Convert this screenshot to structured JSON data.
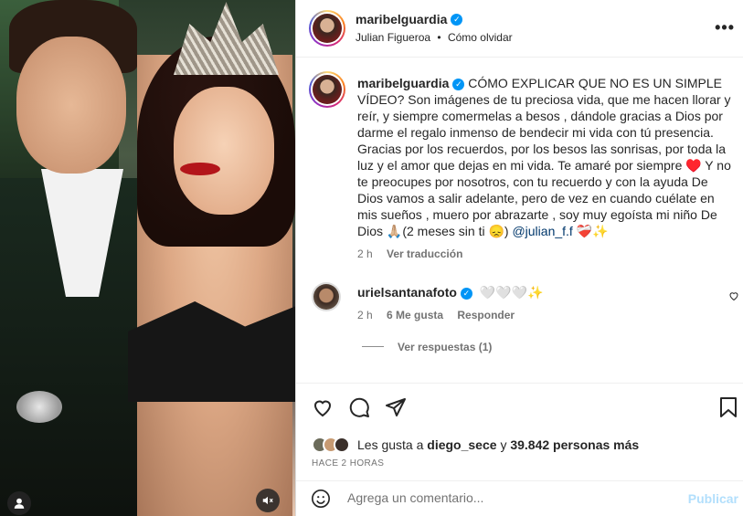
{
  "header": {
    "username": "maribelguardia",
    "subtitle_user": "Julian Figueroa",
    "subtitle_sep": "•",
    "subtitle_audio": "Cómo olvidar",
    "more_glyph": "•••"
  },
  "caption": {
    "username": "maribelguardia",
    "text": "CÓMO EXPLICAR QUE NO ES UN SIMPLE VÍDEO? Son imágenes de tu preciosa vida, que me hacen llorar y reír, y siempre comermelas a besos , dándole gracias a Dios por darme el regalo inmenso de bendecir mi vida con tú presencia. Gracias por los recuerdos, por los besos las sonrisas, por toda la luz y el amor que dejas en mi vida. Te amaré por siempre ♥️ Y no te preocupes por nosotros, con tu recuerdo y con la ayuda De Dios vamos a salir adelante, pero de vez en cuando cuélate en mis sueños , muero por abrazarte , soy muy egoísta mi niño De Dios 🙏🏼(2 meses sin ti 😞)",
    "mention": "@julian_f.f",
    "suffix": " ❤️‍🩹✨",
    "time": "2 h",
    "translate": "Ver traducción"
  },
  "comment": {
    "username": "urielsantanafoto",
    "text": "🤍🤍🤍✨",
    "time": "2 h",
    "likes": "6 Me gusta",
    "reply": "Responder",
    "view_replies": "Ver respuestas (1)"
  },
  "actions": {
    "likes_prefix": "Les gusta a",
    "liker": "diego_sece",
    "likes_joiner": "y",
    "likes_count": "39.842 personas más",
    "time_ago": "HACE 2 HORAS"
  },
  "composer": {
    "placeholder": "Agrega un comentario...",
    "publish": "Publicar"
  },
  "icons": [
    "heart-icon",
    "comment-icon",
    "share-icon",
    "bookmark-icon",
    "emoji-icon",
    "verified-icon",
    "user-icon",
    "mute-icon",
    "more-icon"
  ],
  "colors": {
    "verified": "#0095f6",
    "link": "#00376b",
    "publish_disabled": "#b2dffc"
  }
}
